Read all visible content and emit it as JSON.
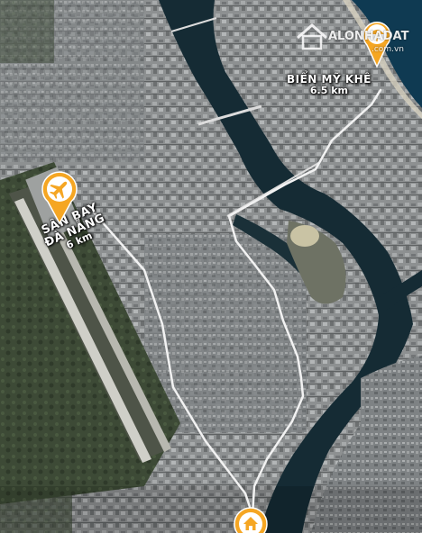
{
  "map": {
    "type": "satellite",
    "route_color": "#f2f2f2",
    "pin_color": "#f5a623"
  },
  "places": {
    "beach": {
      "name": "BIỂN MỸ KHÊ",
      "distance": "6.5 km",
      "icon": "beach-umbrella-icon"
    },
    "airport": {
      "name_line1": "SÂN BAY",
      "name_line2": "ĐÀ NẴNG",
      "distance": "6 km",
      "icon": "airplane-icon"
    },
    "home": {
      "icon": "home-icon"
    }
  },
  "watermark": {
    "brand": "ALONHADAT",
    "domain": ".com.vn"
  }
}
